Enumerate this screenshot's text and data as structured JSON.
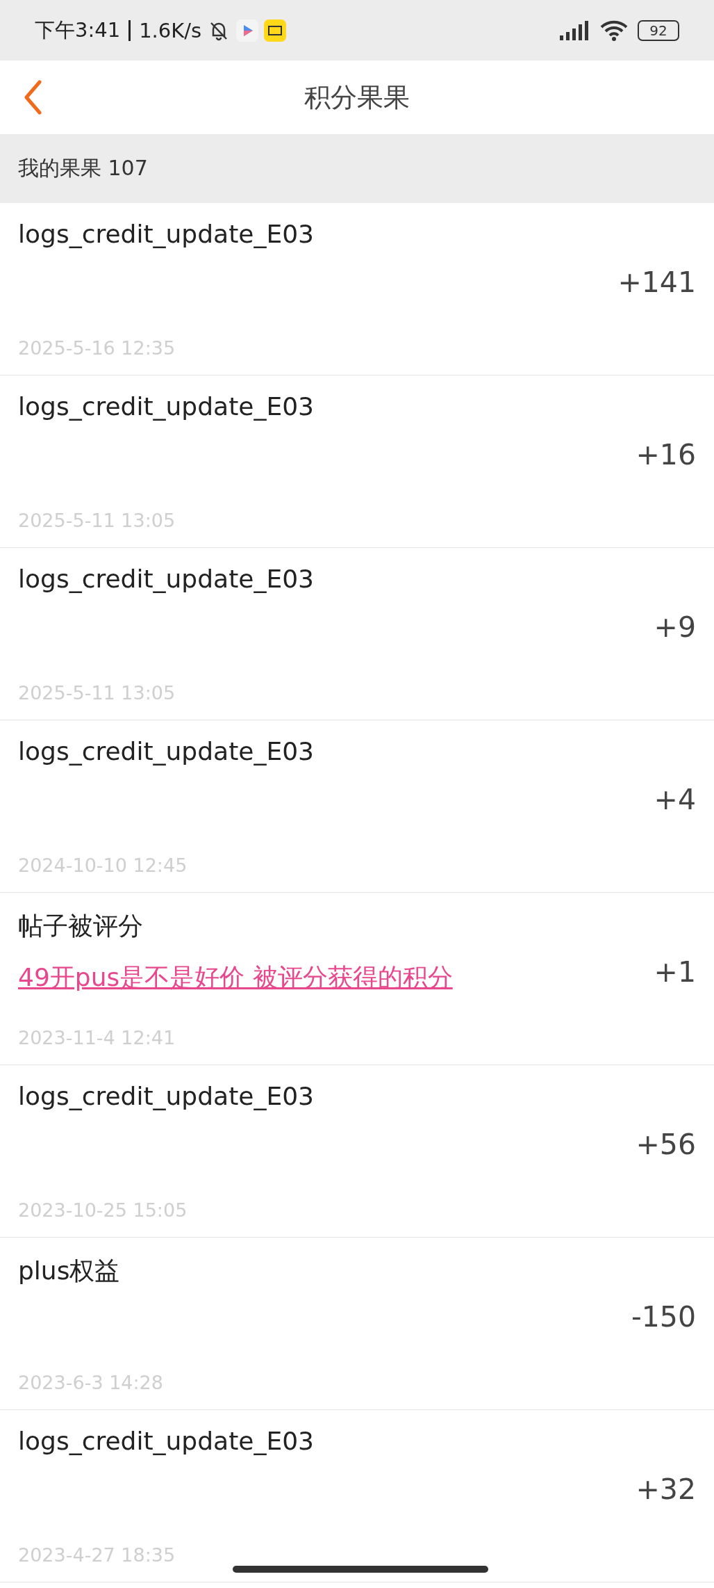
{
  "status_bar": {
    "time": "下午3:41",
    "speed": "1.6K/s",
    "battery": "92"
  },
  "header": {
    "title": "积分果果"
  },
  "summary": "我的果果 107",
  "records": [
    {
      "title": "logs_credit_update_E03",
      "amount": "+141",
      "date": "2025-5-16 12:35"
    },
    {
      "title": "logs_credit_update_E03",
      "amount": "+16",
      "date": "2025-5-11 13:05"
    },
    {
      "title": "logs_credit_update_E03",
      "amount": "+9",
      "date": "2025-5-11 13:05"
    },
    {
      "title": "logs_credit_update_E03",
      "amount": "+4",
      "date": "2024-10-10 12:45"
    },
    {
      "title": "帖子被评分",
      "link": "49开pus是不是好价 被评分获得的积分",
      "amount": "+1",
      "date": "2023-11-4 12:41"
    },
    {
      "title": "logs_credit_update_E03",
      "amount": "+56",
      "date": "2023-10-25 15:05"
    },
    {
      "title": "plus权益",
      "amount": "-150",
      "date": "2023-6-3 14:28"
    },
    {
      "title": "logs_credit_update_E03",
      "amount": "+32",
      "date": "2023-4-27 18:35"
    }
  ]
}
